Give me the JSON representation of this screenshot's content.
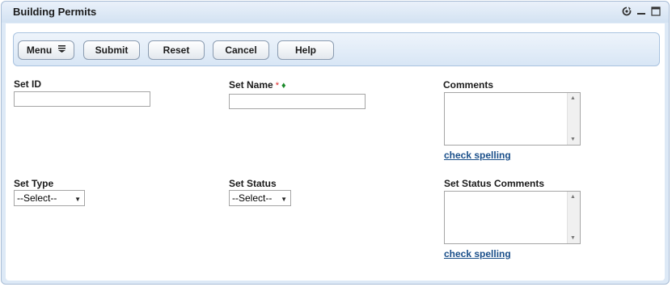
{
  "window": {
    "title": "Building Permits",
    "icons": [
      "refresh-icon",
      "minimize-icon",
      "maximize-icon"
    ]
  },
  "toolbar": {
    "menu_label": "Menu",
    "submit_label": "Submit",
    "reset_label": "Reset",
    "cancel_label": "Cancel",
    "help_label": "Help"
  },
  "form": {
    "set_id": {
      "label": "Set ID",
      "value": ""
    },
    "set_name": {
      "label": "Set Name",
      "required_marker": "*",
      "value": ""
    },
    "comments": {
      "label": "Comments",
      "value": "",
      "spell_link": "check spelling"
    },
    "set_type": {
      "label": "Set Type",
      "selected": "--Select--"
    },
    "set_status": {
      "label": "Set Status",
      "selected": "--Select--"
    },
    "set_status_comments": {
      "label": "Set Status Comments",
      "value": "",
      "spell_link": "check spelling"
    }
  },
  "colors": {
    "accent": "#1a4f8a",
    "required": "#d22222",
    "diamond": "#1a8a2a",
    "panel": "#dde9f6"
  }
}
